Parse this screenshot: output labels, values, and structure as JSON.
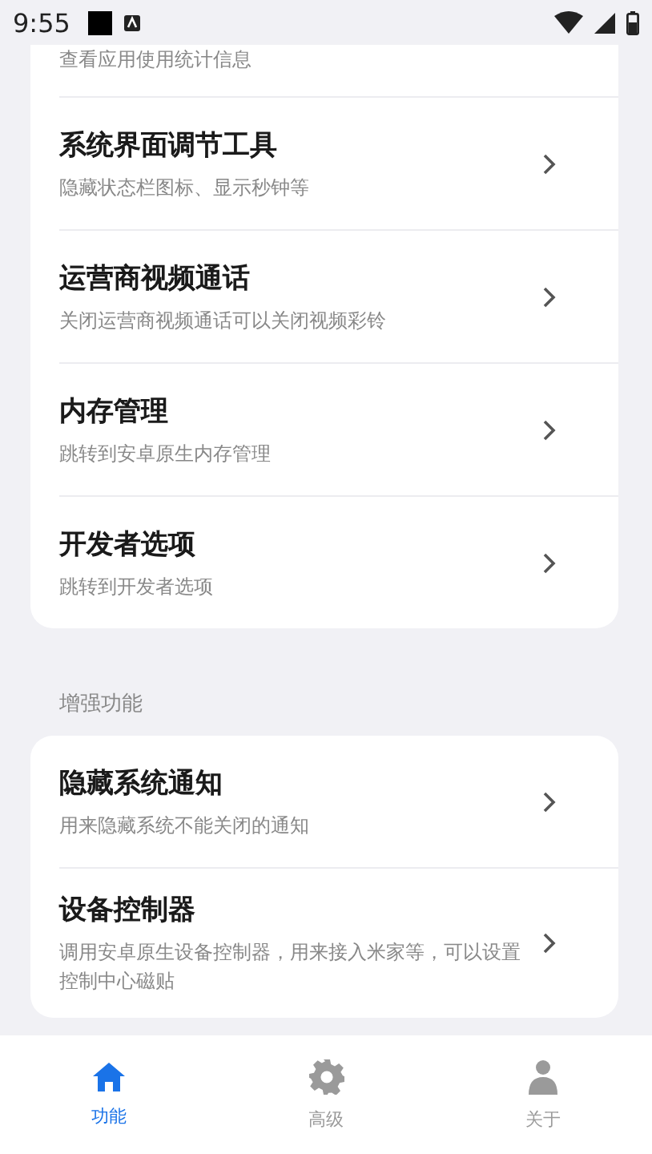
{
  "status_bar": {
    "time": "9:55"
  },
  "sections": [
    {
      "items": [
        {
          "subtitle": "查看应用使用统计信息",
          "partial": true
        },
        {
          "title": "系统界面调节工具",
          "subtitle": "隐藏状态栏图标、显示秒钟等"
        },
        {
          "title": "运营商视频通话",
          "subtitle": "关闭运营商视频通话可以关闭视频彩铃"
        },
        {
          "title": "内存管理",
          "subtitle": "跳转到安卓原生内存管理"
        },
        {
          "title": "开发者选项",
          "subtitle": "跳转到开发者选项"
        }
      ]
    },
    {
      "header": "增强功能",
      "items": [
        {
          "title": "隐藏系统通知",
          "subtitle": "用来隐藏系统不能关闭的通知"
        },
        {
          "title": "设备控制器",
          "subtitle": "调用安卓原生设备控制器，用来接入米家等，可以设置控制中心磁贴"
        }
      ]
    }
  ],
  "bottom_nav": [
    {
      "kind": "home",
      "label": "功能",
      "selected": true
    },
    {
      "kind": "gear",
      "label": "高级",
      "selected": false
    },
    {
      "kind": "person",
      "label": "关于",
      "selected": false
    }
  ]
}
